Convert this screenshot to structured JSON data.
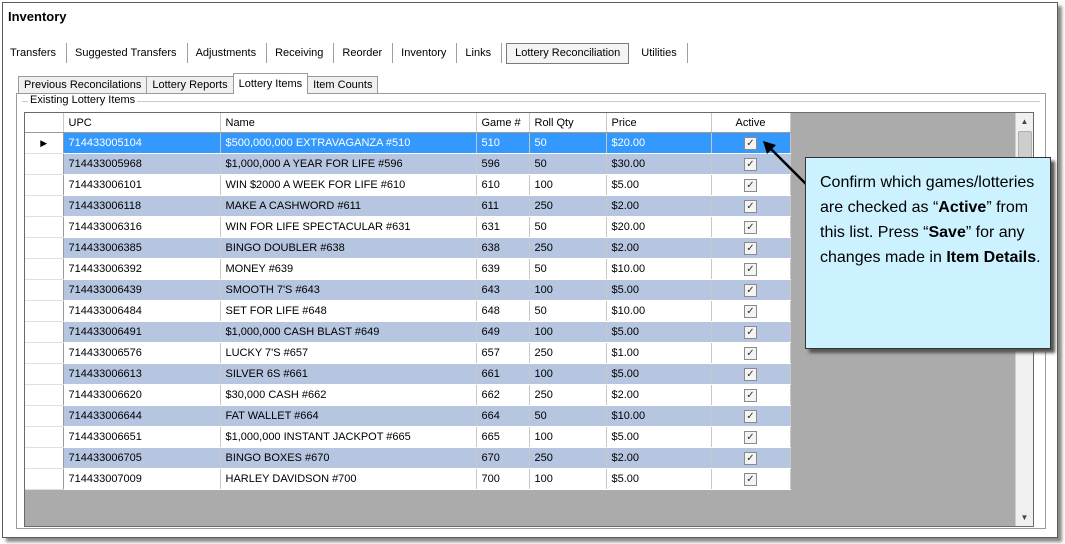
{
  "window": {
    "title": "Inventory"
  },
  "main_tabs": [
    {
      "label": "Transfers"
    },
    {
      "label": "Suggested Transfers"
    },
    {
      "label": "Adjustments"
    },
    {
      "label": "Receiving"
    },
    {
      "label": "Reorder"
    },
    {
      "label": "Inventory"
    },
    {
      "label": "Links"
    },
    {
      "label": "Lottery Reconciliation",
      "active": true
    },
    {
      "label": "Utilities"
    }
  ],
  "sub_tabs": [
    {
      "label": "Previous Reconcilations"
    },
    {
      "label": "Lottery Reports"
    },
    {
      "label": "Lottery Items",
      "active": true
    },
    {
      "label": "Item Counts"
    }
  ],
  "group": {
    "legend": "Existing Lottery Items"
  },
  "table": {
    "columns": [
      "UPC",
      "Name",
      "Game #",
      "Roll Qty",
      "Price",
      "Active"
    ],
    "rows": [
      [
        "714433005104",
        "$500,000,000 EXTRAVAGANZA #510",
        "510",
        "50",
        "$20.00",
        true
      ],
      [
        "714433005968",
        "$1,000,000 A YEAR FOR LIFE #596",
        "596",
        "50",
        "$30.00",
        true
      ],
      [
        "714433006101",
        "WIN $2000 A WEEK FOR LIFE #610",
        "610",
        "100",
        "$5.00",
        true
      ],
      [
        "714433006118",
        "MAKE A CASHWORD #611",
        "611",
        "250",
        "$2.00",
        true
      ],
      [
        "714433006316",
        "WIN FOR LIFE SPECTACULAR #631",
        "631",
        "50",
        "$20.00",
        true
      ],
      [
        "714433006385",
        "BINGO DOUBLER #638",
        "638",
        "250",
        "$2.00",
        true
      ],
      [
        "714433006392",
        "MONEY #639",
        "639",
        "50",
        "$10.00",
        true
      ],
      [
        "714433006439",
        "SMOOTH 7'S #643",
        "643",
        "100",
        "$5.00",
        true
      ],
      [
        "714433006484",
        "SET FOR LIFE #648",
        "648",
        "50",
        "$10.00",
        true
      ],
      [
        "714433006491",
        "$1,000,000 CASH BLAST #649",
        "649",
        "100",
        "$5.00",
        true
      ],
      [
        "714433006576",
        "LUCKY 7'S #657",
        "657",
        "250",
        "$1.00",
        true
      ],
      [
        "714433006613",
        "SILVER 6S #661",
        "661",
        "100",
        "$5.00",
        true
      ],
      [
        "714433006620",
        "$30,000 CASH #662",
        "662",
        "250",
        "$2.00",
        true
      ],
      [
        "714433006644",
        "FAT WALLET #664",
        "664",
        "50",
        "$10.00",
        true
      ],
      [
        "714433006651",
        "$1,000,000 INSTANT JACKPOT #665",
        "665",
        "100",
        "$5.00",
        true
      ],
      [
        "714433006705",
        "BINGO BOXES #670",
        "670",
        "250",
        "$2.00",
        true
      ],
      [
        "714433007009",
        "HARLEY DAVIDSON #700",
        "700",
        "100",
        "$5.00",
        true
      ]
    ],
    "selected_row": 0
  },
  "callout": {
    "part1": "Confirm which games/lotteries are checked as “",
    "bold1": "Active",
    "part2": "” from this list. Press “",
    "bold2": "Save",
    "part3": "” for any changes made in ",
    "bold3": "Item Details",
    "part4": "."
  },
  "icons": {
    "row_indicator": "row-selector-arrow-icon",
    "checkbox": "checkbox-checked-icon",
    "scroll_up": "scroll-up-arrow-icon",
    "scroll_down": "scroll-down-arrow-icon"
  },
  "colors": {
    "selected_row": "#3399ff",
    "alt_row": "#b6c6e0",
    "callout_bg": "#ccf2ff",
    "grid_bg": "#ababab"
  }
}
